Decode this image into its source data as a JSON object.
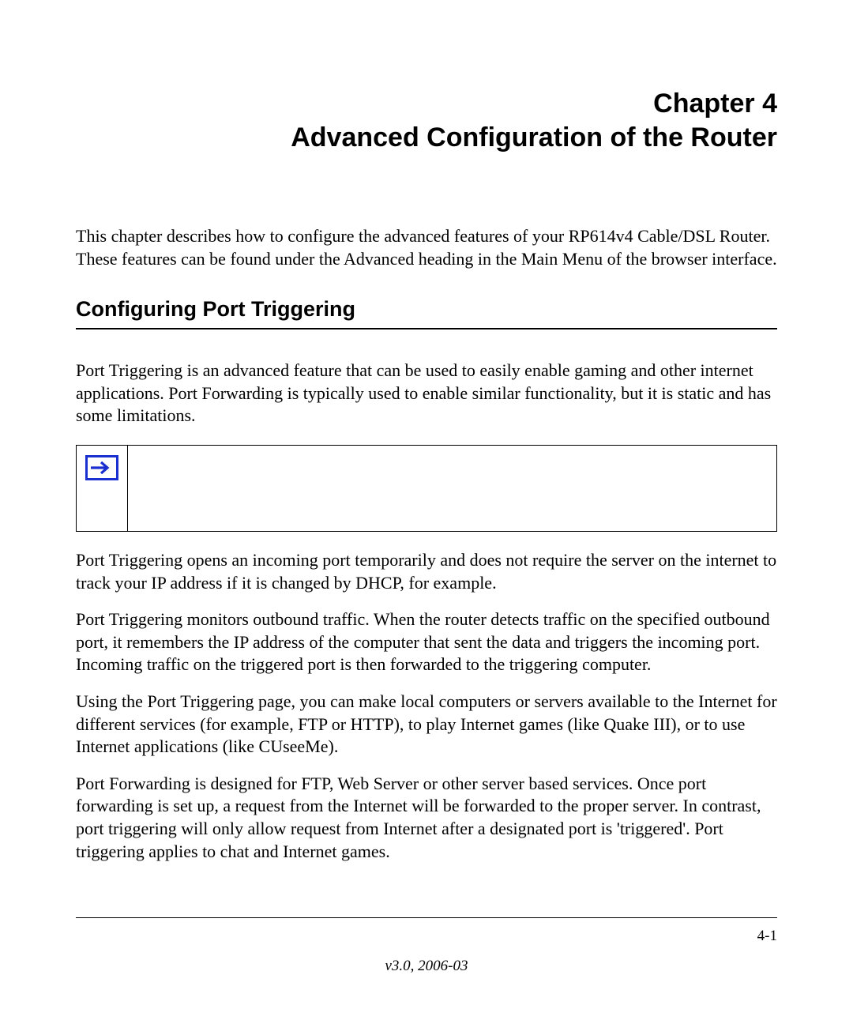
{
  "chapter": {
    "line1": "Chapter 4",
    "line2": "Advanced Configuration of the Router"
  },
  "intro": "This chapter describes how to configure the advanced features of your RP614v4 Cable/DSL Router. These features can be found under the Advanced heading in the Main Menu of the browser interface.",
  "section": {
    "heading": "Configuring Port Triggering",
    "p1": "Port Triggering is an advanced feature that can be used to easily enable gaming and other internet applications. Port Forwarding is typically used to enable similar functionality, but it is static and has some limitations.",
    "p2": "Port Triggering opens an incoming port temporarily and does not require the server on the internet to track your IP address if it is changed by DHCP, for example.",
    "p3": "Port Triggering monitors outbound traffic. When the router detects traffic on the specified outbound port, it remembers the IP address of the computer that sent the data and triggers the incoming port. Incoming traffic on the triggered port is then forwarded to the triggering computer.",
    "p4": "Using the Port Triggering page, you can make local computers or servers available to the Internet for different services (for example, FTP or HTTP), to play Internet games (like Quake III), or to use Internet applications (like CUseeMe).",
    "p5": "Port Forwarding is designed for FTP, Web Server or other server based services. Once port forwarding is set up, a request from the Internet will be forwarded to the proper server. In contrast, port triggering will only allow request from Internet after a designated port is 'triggered'. Port triggering applies to chat and Internet games."
  },
  "note": {
    "text": ""
  },
  "footer": {
    "page": "4-1",
    "version": "v3.0, 2006-03"
  },
  "colors": {
    "arrow": "#1a2fd0"
  }
}
